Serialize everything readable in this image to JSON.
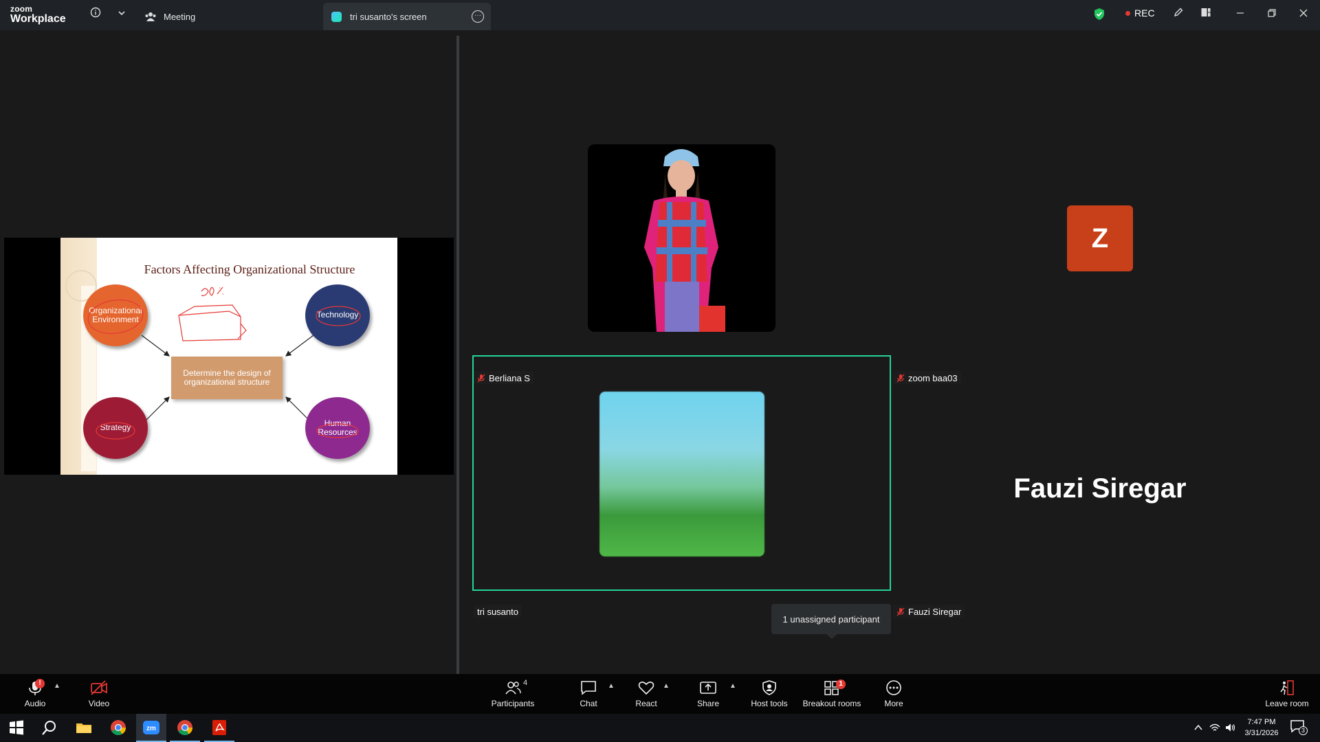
{
  "app": {
    "brand_top": "zoom",
    "brand_bottom": "Workplace"
  },
  "tabs": {
    "meeting": "Meeting",
    "screen": "tri susanto's screen"
  },
  "status": {
    "rec_label": "REC"
  },
  "slide": {
    "title": "Factors Affecting Organizational Structure",
    "env": "Organizational Environment",
    "tech": "Technology",
    "strategy": "Strategy",
    "hr": "Human Resources",
    "center": "Determine the design of organizational structure"
  },
  "participants": {
    "berliana": "Berliana S",
    "zoom": "zoom baa03",
    "tri": "tri susanto",
    "fauzi": "Fauzi Siregar",
    "avatar_letter": "Z",
    "big_name": "Fauzi Siregar"
  },
  "tooltip": "1 unassigned participant",
  "toolbar": {
    "audio": "Audio",
    "video": "Video",
    "participants": "Participants",
    "participants_count": "4",
    "chat": "Chat",
    "react": "React",
    "share": "Share",
    "host_tools": "Host tools",
    "breakout": "Breakout rooms",
    "breakout_badge": "1",
    "more": "More",
    "leave": "Leave room",
    "audio_badge": "!"
  },
  "taskbar": {
    "time": "7:47 PM",
    "date": "3/31/2026",
    "notif_count": "3"
  },
  "colors": {
    "active_border": "#24d49a",
    "avatar": "#c8401a",
    "rec_dot": "#e53935"
  }
}
